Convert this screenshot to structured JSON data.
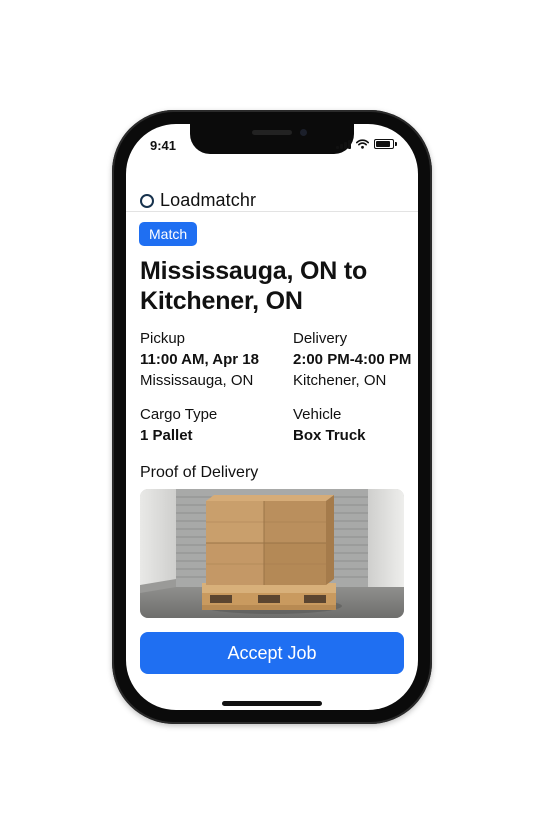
{
  "status_bar": {
    "time": "9:41"
  },
  "app": {
    "title": "Loadmatchr"
  },
  "job": {
    "badge": "Match",
    "route_title": "Mississauga, ON to Kitchener, ON",
    "pickup": {
      "label": "Pickup",
      "time": "11:00 AM, Apr 18",
      "location": "Mississauga, ON"
    },
    "delivery": {
      "label": "Delivery",
      "time": "2:00 PM-4:00 PM",
      "location": "Kitchener, ON"
    },
    "cargo": {
      "label": "Cargo Type",
      "value": "1 Pallet"
    },
    "vehicle": {
      "label": "Vehicle",
      "value": "Box Truck"
    },
    "proof_label": "Proof of Delivery"
  },
  "actions": {
    "accept_label": "Accept Job"
  },
  "colors": {
    "accent": "#1f6ff2",
    "logo": "#17324d"
  }
}
